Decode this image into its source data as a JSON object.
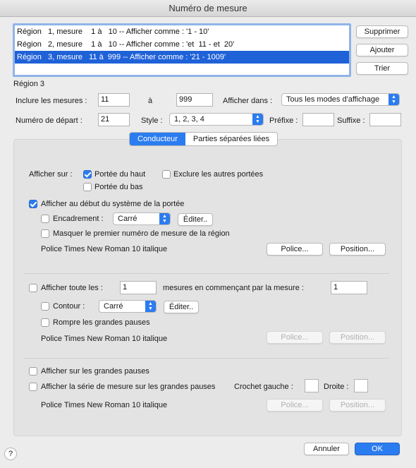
{
  "window": {
    "title": "Numéro de mesure"
  },
  "regions": [
    {
      "text": "Région   1, mesure    1 à   10 -- Afficher comme : '1 - 10'",
      "selected": false
    },
    {
      "text": "Région   2, mesure    1 à   10 -- Afficher comme : 'et  11 - et  20'",
      "selected": false
    },
    {
      "text": "Région   3, mesure   11 à  999 -- Afficher comme : '21 - 1009'",
      "selected": true
    }
  ],
  "side_buttons": {
    "delete": "Supprimer",
    "add": "Ajouter",
    "sort": "Trier"
  },
  "region_label": "Région 3",
  "range": {
    "include_label": "Inclure les mesures :",
    "from": "11",
    "to_label": "à",
    "to": "999"
  },
  "display_in": {
    "label": "Afficher dans :",
    "value": "Tous les modes d'affichage"
  },
  "start": {
    "label": "Numéro de départ :",
    "value": "21"
  },
  "style": {
    "label": "Style :",
    "value": "1, 2, 3, 4"
  },
  "prefix": {
    "label": "Préfixe :",
    "value": ""
  },
  "suffix": {
    "label": "Suffixe :",
    "value": ""
  },
  "tabs": {
    "score": "Conducteur",
    "parts": "Parties séparées liées",
    "active": "score"
  },
  "section1": {
    "show_on_label": "Afficher sur :",
    "top_staff": {
      "label": "Portée du haut",
      "checked": true
    },
    "exclude_others": {
      "label": "Exclure les autres portées",
      "checked": false
    },
    "bottom_staff": {
      "label": "Portée du bas",
      "checked": false
    },
    "show_at_start": {
      "label": "Afficher au début du système de la portée",
      "checked": true
    },
    "frame": {
      "label": "Encadrement :",
      "checked": false,
      "value": "Carré",
      "edit": "Éditer.."
    },
    "hide_first": {
      "label": "Masquer le premier numéro de mesure de la région",
      "checked": false
    },
    "font": "Police  Times New Roman 10  italique",
    "font_button": "Police...",
    "position_button": "Position..."
  },
  "section2": {
    "show_every": {
      "label": "Afficher toute les :",
      "checked": false,
      "value": "1"
    },
    "starting_label": "mesures en commençant par la mesure :",
    "starting_value": "1",
    "contour": {
      "label": "Contour :",
      "checked": false,
      "value": "Carré",
      "edit": "Éditer.."
    },
    "break_rests": {
      "label": "Rompre les grandes pauses",
      "checked": false
    },
    "font": "Police Times New Roman 10  italique",
    "font_button": "Police...",
    "position_button": "Position..."
  },
  "section3": {
    "show_on_rests": {
      "label": "Afficher sur les grandes pauses",
      "checked": false
    },
    "show_series": {
      "label": "Afficher la série de mesure sur les grandes pauses",
      "checked": false
    },
    "left_bracket": {
      "label": "Crochet gauche :",
      "value": ""
    },
    "right_bracket": {
      "label": "Droite :",
      "value": ""
    },
    "font": "Police Times New Roman 10  italique",
    "font_button": "Police...",
    "position_button": "Position..."
  },
  "footer": {
    "help": "?",
    "cancel": "Annuler",
    "ok": "OK"
  },
  "colors": {
    "accent": "#2b7cf0",
    "selection": "#1f62d8"
  }
}
